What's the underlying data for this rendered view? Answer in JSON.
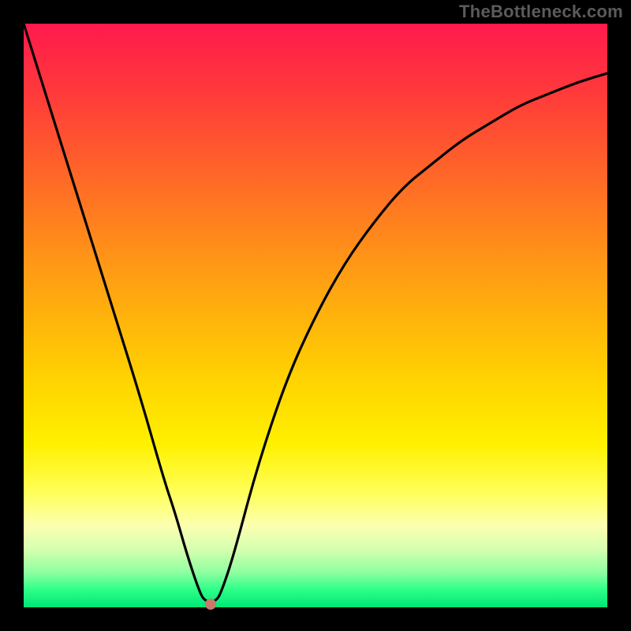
{
  "watermark": "TheBottleneck.com",
  "chart_data": {
    "type": "line",
    "title": "",
    "xlabel": "",
    "ylabel": "",
    "xlim": [
      0,
      1
    ],
    "ylim": [
      0,
      1
    ],
    "series": [
      {
        "name": "curve",
        "x": [
          0.0,
          0.05,
          0.1,
          0.15,
          0.2,
          0.24,
          0.26,
          0.28,
          0.3,
          0.31,
          0.33,
          0.34,
          0.36,
          0.4,
          0.45,
          0.5,
          0.55,
          0.6,
          0.65,
          0.7,
          0.75,
          0.8,
          0.85,
          0.9,
          0.95,
          1.0
        ],
        "y_pct": [
          1.0,
          0.84,
          0.68,
          0.52,
          0.36,
          0.22,
          0.16,
          0.09,
          0.03,
          0.01,
          0.01,
          0.03,
          0.09,
          0.24,
          0.39,
          0.5,
          0.59,
          0.66,
          0.72,
          0.76,
          0.8,
          0.83,
          0.86,
          0.88,
          0.9,
          0.915
        ]
      }
    ],
    "minimum_marker": {
      "x": 0.32,
      "y_pct": 0.006
    },
    "colors": {
      "background_top": "#ff1a4d",
      "background_bottom": "#00e676",
      "curve": "#000000",
      "marker": "#c77a6a",
      "frame": "#000000"
    }
  }
}
